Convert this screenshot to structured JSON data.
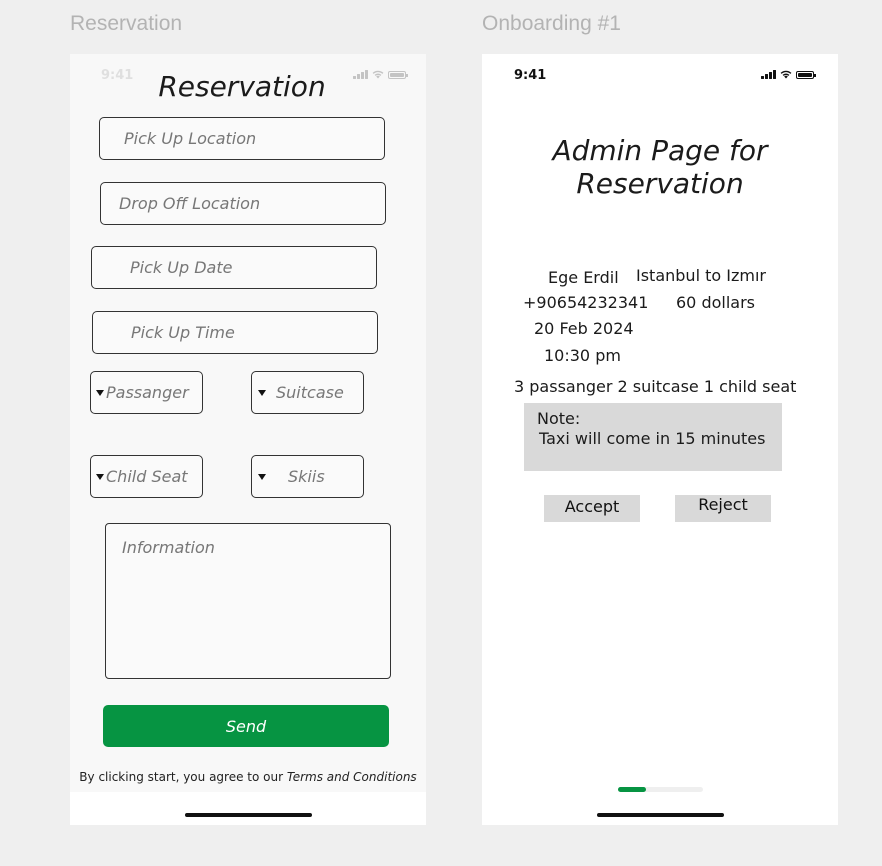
{
  "frames": {
    "left_label": "Reservation",
    "right_label": "Onboarding #1"
  },
  "left": {
    "status_time": "9:41",
    "title": "Reservation",
    "pickup_location": "Pick Up Location",
    "dropoff_location": "Drop Off Location",
    "pickup_date": "Pick Up Date",
    "pickup_time": "Pick Up Time",
    "passenger": "Passanger",
    "suitcase": "Suitcase",
    "child_seat": "Child Seat",
    "skiis": "Skiis",
    "information": "Information",
    "send": "Send",
    "terms_prefix": "By clicking start, you agree to our ",
    "terms_link": "Terms and Conditions"
  },
  "right": {
    "status_time": "9:41",
    "title_line1": "Admin Page for",
    "title_line2": "Reservation",
    "name": "Ege Erdil",
    "route": "Istanbul to Izmır",
    "phone": "+90654232341",
    "price": "60 dollars",
    "date": "20 Feb 2024",
    "time": "10:30 pm",
    "details": "3 passanger 2 suitcase 1 child seat",
    "note_label": "Note:",
    "note_text": "Taxi will come in 15 minutes",
    "accept": "Accept",
    "reject": "Reject",
    "onboarding_progress": 0.33
  },
  "colors": {
    "accent": "#069442",
    "canvas": "#efefef",
    "note_bg": "#d9d9d9"
  },
  "icons": [
    "signal-icon",
    "wifi-icon",
    "battery-icon",
    "dropdown-caret-icon"
  ]
}
